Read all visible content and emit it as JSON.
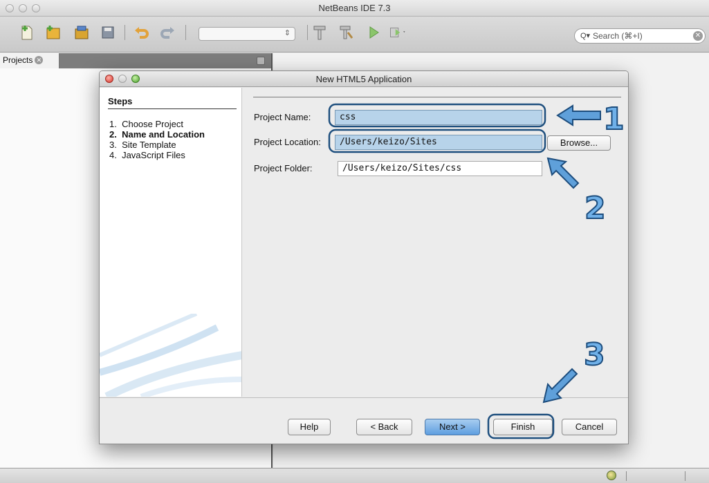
{
  "ide": {
    "title": "NetBeans IDE 7.3",
    "search_placeholder": "Search (⌘+I)",
    "projects_tab": "Projects"
  },
  "dialog": {
    "title": "New HTML5 Application",
    "steps_title": "Steps",
    "steps": [
      {
        "num": "1.",
        "label": "Choose Project",
        "current": false
      },
      {
        "num": "2.",
        "label": "Name and Location",
        "current": true
      },
      {
        "num": "3.",
        "label": "Site Template",
        "current": false
      },
      {
        "num": "4.",
        "label": "JavaScript Files",
        "current": false
      }
    ],
    "project_name_label": "Project Name:",
    "project_name_value": "css",
    "project_location_label": "Project Location:",
    "project_location_value": "/Users/keizo/Sites",
    "project_folder_label": "Project Folder:",
    "project_folder_value": "/Users/keizo/Sites/css",
    "browse_label": "Browse...",
    "buttons": {
      "help": "Help",
      "back": "< Back",
      "next": "Next >",
      "finish": "Finish",
      "cancel": "Cancel"
    }
  },
  "annotations": {
    "one": "1",
    "two": "2",
    "three": "3",
    "color": "#2e6fa7"
  }
}
